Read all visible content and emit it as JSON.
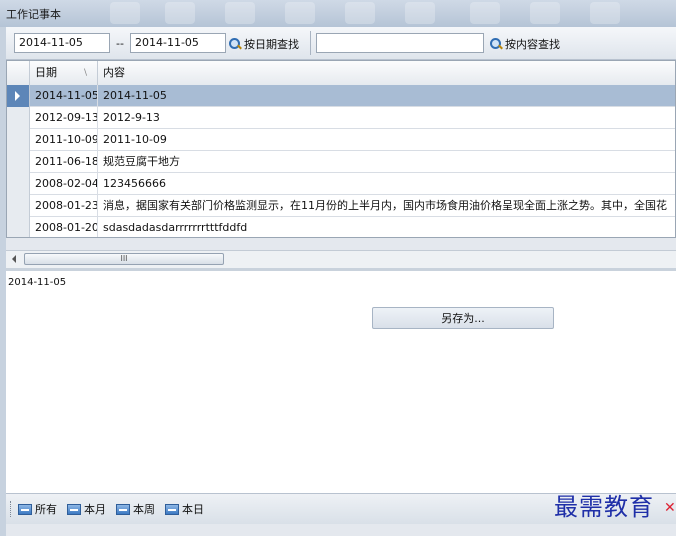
{
  "window": {
    "title": "工作记事本"
  },
  "toolbar": {
    "date_from": "2014-11-05",
    "range_sep": "--",
    "date_to": "2014-11-05",
    "date_search_label": "按日期查找",
    "content_value": "",
    "content_search_label": "按内容查找"
  },
  "grid": {
    "columns": [
      "日期",
      "内容"
    ],
    "rows": [
      {
        "date": "2014-11-05",
        "content": "2014-11-05",
        "selected": true
      },
      {
        "date": "2012-09-13",
        "content": "2012-9-13"
      },
      {
        "date": "2011-10-09",
        "content": "2011-10-09"
      },
      {
        "date": "2011-06-18",
        "content": "规范豆腐干地方"
      },
      {
        "date": "2008-02-04",
        "content": "123456666"
      },
      {
        "date": "2008-01-23",
        "content": "消息，据国家有关部门价格监测显示，在11月份的上半月内，国内市场食用油价格呈现全面上涨之势。其中，全国花"
      },
      {
        "date": "2008-01-20",
        "content": "sdasdadasdarrrrrrrtttfddfd"
      }
    ],
    "scroll_thumb_label": "III"
  },
  "detail": {
    "text": "2014-11-05",
    "save_as_label": "另存为..."
  },
  "filters": {
    "all": "所有",
    "month": "本月",
    "week": "本周",
    "day": "本日"
  },
  "watermark": "最需教育",
  "colors": {
    "selection": "#a8bcd4",
    "accent": "#2f6db3"
  }
}
